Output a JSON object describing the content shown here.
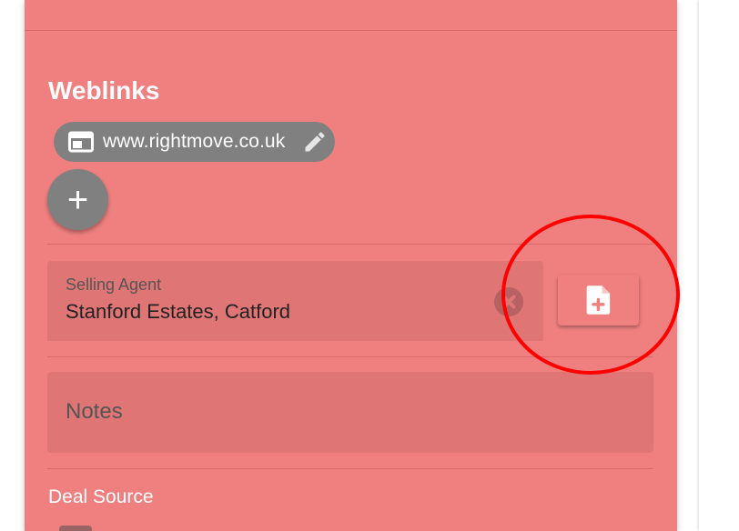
{
  "weblinks": {
    "title": "Weblinks",
    "chip": {
      "label": "www.rightmove.co.uk",
      "icon": "web-window-icon",
      "edit_icon": "pencil-icon"
    },
    "add_button": {
      "icon": "plus-icon",
      "glyph": "+"
    }
  },
  "selling_agent": {
    "label": "Selling Agent",
    "value": "Stanford Estates, Catford",
    "clear_icon": "clear-circle-icon"
  },
  "add_document": {
    "icon": "file-add-icon"
  },
  "notes": {
    "label": "Notes"
  },
  "deal_source": {
    "label": "Deal Source"
  },
  "colors": {
    "card_background": "#f08080",
    "field_background": "#e07575",
    "chip_background": "#808080",
    "annotation": "#ff0000"
  }
}
